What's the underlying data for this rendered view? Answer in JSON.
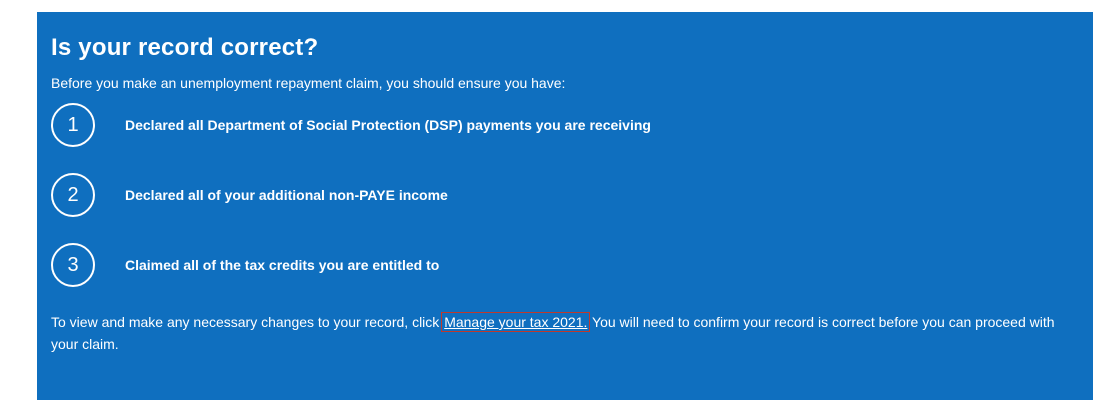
{
  "panel": {
    "title": "Is your record correct?",
    "intro": "Before you make an unemployment repayment claim, you should ensure you have:",
    "steps": [
      {
        "number": "1",
        "text": "Declared all Department of Social Protection (DSP) payments you are receiving"
      },
      {
        "number": "2",
        "text": "Declared all of your additional non-PAYE income"
      },
      {
        "number": "3",
        "text": "Claimed all of the tax credits you are entitled to"
      }
    ],
    "footer": {
      "before": "To view and make any necessary changes to your record, click ",
      "link": "Manage your tax 2021.",
      "after": " You will need to confirm your record is correct before you can proceed with your claim."
    }
  },
  "colors": {
    "panel_background": "#0f6fbf",
    "text": "#ffffff",
    "link_focus_outline": "#c0392b"
  }
}
